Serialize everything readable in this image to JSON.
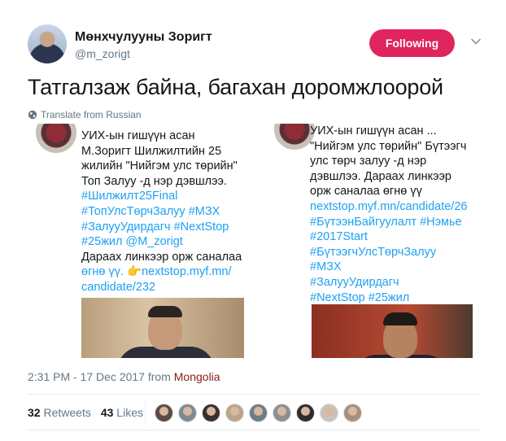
{
  "user": {
    "name": "Мөнхчулууны Зоригт",
    "handle": "@m_zorigt"
  },
  "follow_button": {
    "label": "Following",
    "color": "#e0245e"
  },
  "menu_icon": "chevron-down-icon",
  "tweet": {
    "text": "Татгалзаж байна, багахан доромжлоорой",
    "translate_label": "Translate from Russian",
    "translate_icon": "globe-icon"
  },
  "media": {
    "left": {
      "lines": [
        {
          "text": "УИХ-ын гишүүн асан",
          "kind": "plain"
        },
        {
          "text": "М.Зоригт Шилжилтийн 25",
          "kind": "plain"
        },
        {
          "text": "жилийн \"Нийгэм улс төрийн\"",
          "kind": "plain"
        },
        {
          "text": "Топ Залуу -д нэр дэвшлээ.",
          "kind": "plain"
        },
        {
          "text": "#Шилжилт25Final",
          "kind": "tag"
        },
        {
          "text": "#ТопУлсТөрчЗалуу #МЗХ",
          "kind": "tag"
        },
        {
          "text": "#ЗалууУдирдагч #NextStop",
          "kind": "tag"
        },
        {
          "text": "#25жил @M_zorigt",
          "kind": "tag"
        },
        {
          "text": "Дараах линкээр орж саналаа",
          "kind": "plain"
        },
        {
          "text": "өгнө үү. 👉nextstop.myf.mn/",
          "kind": "link"
        },
        {
          "text": "candidate/232",
          "kind": "link"
        }
      ]
    },
    "right": {
      "lines": [
        {
          "text": "УИХ-ын гишүүн асан ...",
          "kind": "plain"
        },
        {
          "text": "\"Нийгэм улс төрийн\" Бүтээгч",
          "kind": "plain"
        },
        {
          "text": "улс төрч залуу -д нэр",
          "kind": "plain"
        },
        {
          "text": "дэвшлээ. Дараах линкээр",
          "kind": "plain"
        },
        {
          "text": "орж саналаа өгнө үү",
          "kind": "plain"
        },
        {
          "text": "nextstop.myf.mn/candidate/26",
          "kind": "link"
        },
        {
          "text": "#БүтээнБайгуулалт #Нэмье",
          "kind": "tag"
        },
        {
          "text": "#2017Start",
          "kind": "tag"
        },
        {
          "text": "#БүтээгчУлсТөрчЗалуу",
          "kind": "tag"
        },
        {
          "text": "#МЗХ",
          "kind": "tag"
        },
        {
          "text": "#ЗалууУдирдагч",
          "kind": "tag"
        },
        {
          "text": "#NextStop #25жил",
          "kind": "tag"
        }
      ]
    }
  },
  "meta": {
    "time": "2:31 PM - 17 Dec 2017",
    "from_label": "from",
    "location": "Mongolia"
  },
  "stats": {
    "retweets_count": "32",
    "retweets_label": "Retweets",
    "likes_count": "43",
    "likes_label": "Likes",
    "liker_colors": [
      "#5b4a44",
      "#7d8a91",
      "#3a2f2d",
      "#b9a58d",
      "#6e7c86",
      "#8a8f93",
      "#2f2b2e",
      "#c7c2bb",
      "#a48f7f"
    ]
  }
}
